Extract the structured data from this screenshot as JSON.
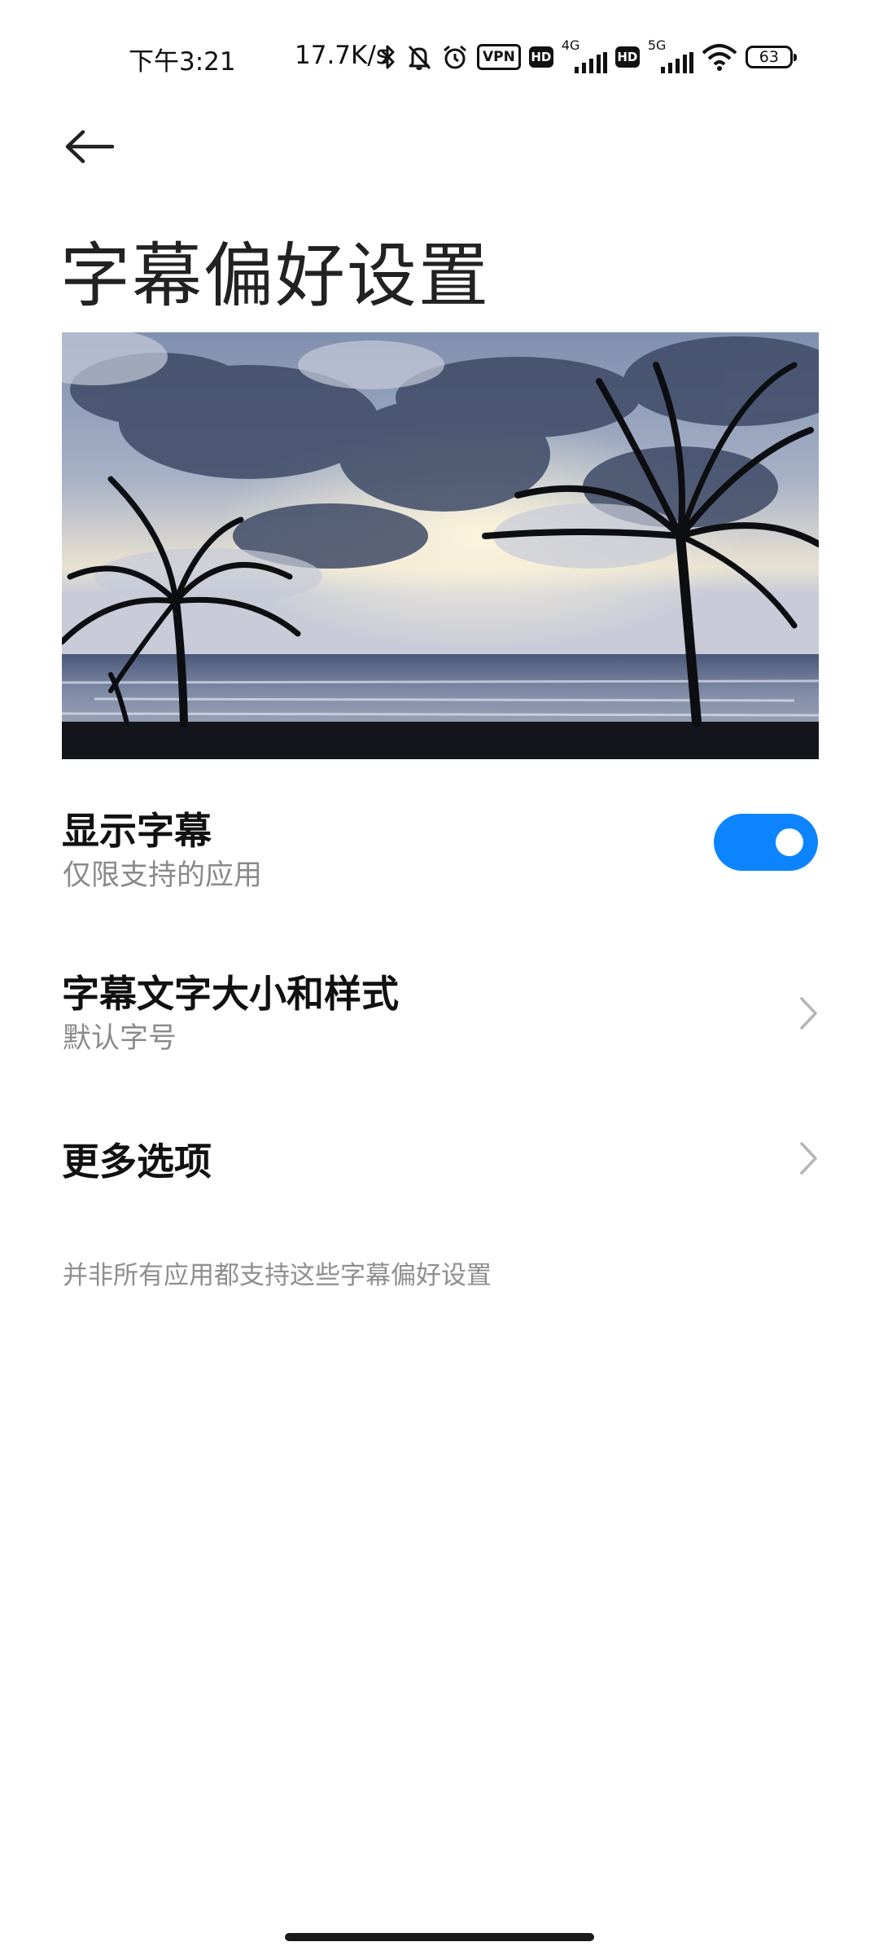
{
  "status_bar": {
    "time": "下午3:21",
    "net_speed": "17.7K/s",
    "vpn": "VPN",
    "hd1": "HD",
    "gen1": "4G",
    "hd2": "HD",
    "gen2": "5G",
    "battery": "63",
    "icons": [
      "bluetooth-icon",
      "mute-bell-icon",
      "alarm-icon",
      "vpn-icon",
      "hd-icon",
      "signal-4g-icon",
      "hd-icon",
      "signal-5g-icon",
      "wifi-icon",
      "battery-icon"
    ]
  },
  "header": {
    "back_icon": "arrow-left-icon",
    "title": "字幕偏好设置"
  },
  "preview": {
    "description_icon": "caption-preview-image"
  },
  "settings": [
    {
      "title": "显示字幕",
      "subtitle": "仅限支持的应用",
      "control": "toggle",
      "enabled": true
    },
    {
      "title": "字幕文字大小和样式",
      "subtitle": "默认字号",
      "control": "chevron-right-icon"
    },
    {
      "title": "更多选项",
      "control": "chevron-right-icon"
    }
  ],
  "footnote": "并非所有应用都支持这些字幕偏好设置",
  "colors": {
    "accent": "#0d84ff",
    "secondary_text": "#8a8a8a",
    "background": "#ffffff"
  }
}
